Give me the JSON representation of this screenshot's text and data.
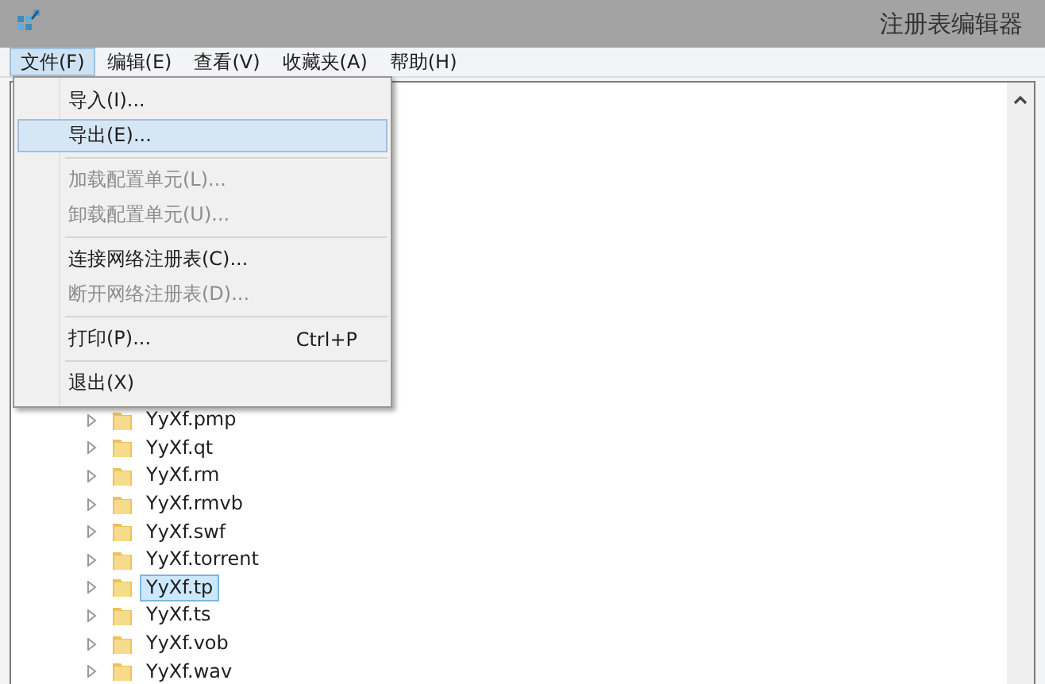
{
  "window": {
    "title": "注册表编辑器"
  },
  "menu_bar": [
    {
      "label": "文件(F)",
      "selected": true
    },
    {
      "label": "编辑(E)",
      "selected": false
    },
    {
      "label": "查看(V)",
      "selected": false
    },
    {
      "label": "收藏夹(A)",
      "selected": false
    },
    {
      "label": "帮助(H)",
      "selected": false
    }
  ],
  "file_menu": [
    {
      "kind": "item",
      "label": "导入(I)...",
      "disabled": false,
      "selected": false
    },
    {
      "kind": "item",
      "label": "导出(E)...",
      "disabled": false,
      "selected": true
    },
    {
      "kind": "separator"
    },
    {
      "kind": "item",
      "label": "加载配置单元(L)...",
      "disabled": true,
      "selected": false
    },
    {
      "kind": "item",
      "label": "卸载配置单元(U)...",
      "disabled": true,
      "selected": false
    },
    {
      "kind": "separator"
    },
    {
      "kind": "item",
      "label": "连接网络注册表(C)...",
      "disabled": false,
      "selected": false
    },
    {
      "kind": "item",
      "label": "断开网络注册表(D)...",
      "disabled": true,
      "selected": false
    },
    {
      "kind": "separator"
    },
    {
      "kind": "item",
      "label": "打印(P)...",
      "shortcut": "Ctrl+P",
      "disabled": false,
      "selected": false
    },
    {
      "kind": "separator"
    },
    {
      "kind": "item",
      "label": "退出(X)",
      "disabled": false,
      "selected": false
    }
  ],
  "tree": [
    {
      "label": "YyXf.pmp",
      "selected": false
    },
    {
      "label": "YyXf.qt",
      "selected": false
    },
    {
      "label": "YyXf.rm",
      "selected": false
    },
    {
      "label": "YyXf.rmvb",
      "selected": false
    },
    {
      "label": "YyXf.swf",
      "selected": false
    },
    {
      "label": "YyXf.torrent",
      "selected": false
    },
    {
      "label": "YyXf.tp",
      "selected": true
    },
    {
      "label": "YyXf.ts",
      "selected": false
    },
    {
      "label": "YyXf.vob",
      "selected": false
    },
    {
      "label": "YyXf.wav",
      "selected": false
    }
  ]
}
